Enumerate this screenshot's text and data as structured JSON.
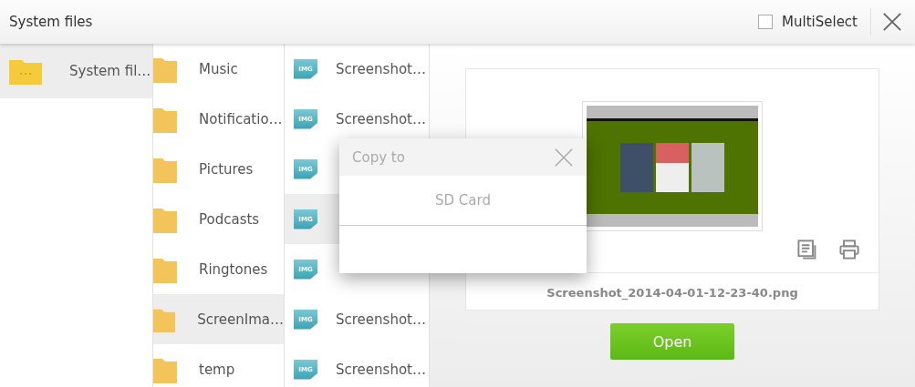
{
  "header": {
    "title": "System files",
    "multiselect": {
      "label": "MultiSelect",
      "checked": false
    }
  },
  "locations": [
    {
      "name": "System fil…",
      "selected": true
    }
  ],
  "folders": [
    {
      "name": "Music",
      "selected": false
    },
    {
      "name": "Notificatio…",
      "selected": false
    },
    {
      "name": "Pictures",
      "selected": false
    },
    {
      "name": "Podcasts",
      "selected": false
    },
    {
      "name": "Ringtones",
      "selected": false
    },
    {
      "name": "ScreenIma…",
      "selected": true
    },
    {
      "name": "temp",
      "selected": false
    }
  ],
  "files": [
    {
      "badge": "IMG",
      "name": "Screenshot…",
      "selected": false
    },
    {
      "badge": "IMG",
      "name": "Screenshot…",
      "selected": false
    },
    {
      "badge": "IMG",
      "selected": false
    },
    {
      "badge": "IMG",
      "selected": true
    },
    {
      "badge": "IMG",
      "selected": false
    },
    {
      "badge": "IMG",
      "name": "Screenshot…",
      "selected": false
    },
    {
      "badge": "IMG",
      "name": "Screenshot…",
      "selected": false
    }
  ],
  "preview": {
    "filename": "Screenshot_2014-04-01-12-23-40.png",
    "open_button": "Open"
  },
  "dialog": {
    "title": "Copy to",
    "options": [
      "SD Card"
    ]
  }
}
